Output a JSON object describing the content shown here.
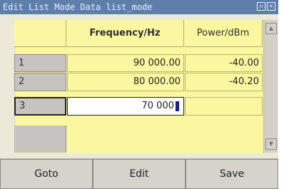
{
  "window": {
    "title": "Edit List Mode Data list_mode"
  },
  "table": {
    "columns": [
      "Frequency/Hz",
      "Power/dBm"
    ],
    "rows": [
      {
        "index": "1",
        "frequency": "90 000.00",
        "power": "-40.00"
      },
      {
        "index": "2",
        "frequency": "80 000.00",
        "power": "-40.20"
      },
      {
        "index": "3",
        "frequency": "70 000",
        "power": ""
      }
    ]
  },
  "buttons": {
    "goto": "Goto",
    "edit": "Edit",
    "save": "Save"
  },
  "icons": {
    "restore": "restore-icon",
    "close": "close-icon",
    "scroll_up": "arrow-up-icon",
    "scroll_down": "arrow-down-icon"
  },
  "colors": {
    "titlebar": "#5f7fab",
    "table_bg": "#fbf7a0",
    "row_label": "#c6c3c1",
    "caret": "#1a1a8a"
  }
}
